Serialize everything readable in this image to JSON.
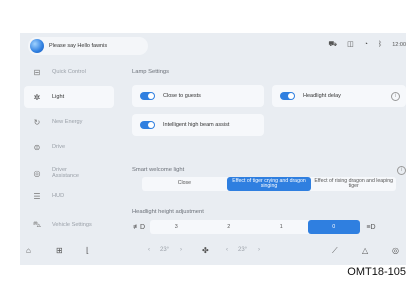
{
  "assistant": {
    "prompt": "Please say Hello fawnis"
  },
  "status": {
    "icons": [
      "car-icon",
      "window-icon",
      "signal-icon",
      "bluetooth-icon"
    ],
    "time": "12:00"
  },
  "sidebar": {
    "items": [
      {
        "label": "Quick Control",
        "icon": "quick-control-icon",
        "active": false
      },
      {
        "label": "Light",
        "icon": "light-icon",
        "active": true
      },
      {
        "label": "New Energy",
        "icon": "new-energy-icon",
        "active": false
      },
      {
        "label": "Drive",
        "icon": "drive-icon",
        "active": false
      },
      {
        "label": "Driver Assistance",
        "icon": "driver-assistance-icon",
        "active": false
      },
      {
        "label": "HUD",
        "icon": "hud-icon",
        "active": false
      },
      {
        "label": "Vehicle Settings",
        "icon": "vehicle-settings-icon",
        "active": false
      }
    ]
  },
  "lamp": {
    "title": "Lamp Settings",
    "close_to_guests": "Close to guests",
    "headlight_delay": "Headlight delay",
    "high_beam_assist": "Intelligent high beam assist",
    "toggle_states": {
      "close_to_guests": true,
      "headlight_delay": true,
      "high_beam_assist": true
    }
  },
  "welcome": {
    "title": "Smart welcome light",
    "options": [
      "Close",
      "Effect of tiger crying and dragon singing",
      "Effect of rising dragon and leaping tiger"
    ],
    "selected_index": 1
  },
  "headlight_height": {
    "title": "Headlight height adjustment",
    "options": [
      "3",
      "2",
      "1",
      "0"
    ],
    "selected_index": 3
  },
  "bottom": {
    "left_temp": "23°",
    "right_temp": "23°",
    "left_arrow": "‹",
    "right_arrow": "›"
  },
  "caption": "OMT18-105",
  "colors": {
    "accent": "#2f7fe0",
    "background": "#e9edf2",
    "card": "#f6f8fb"
  }
}
